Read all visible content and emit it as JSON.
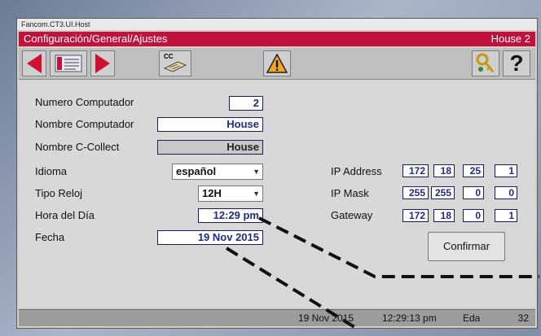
{
  "window": {
    "title": "Fancom.CT3.UI.Host"
  },
  "header": {
    "path": "Configuración/General/Ajustes",
    "house": "House 2"
  },
  "toolbar": {
    "back": "arrow-left-icon",
    "list": "list-card-icon",
    "forward": "arrow-right-icon",
    "cc_label": "CC",
    "warning": "warning-icon",
    "key": "key-icon",
    "help": "?"
  },
  "form": {
    "numero_computador": {
      "label": "Numero Computador",
      "value": "2"
    },
    "nombre_computador": {
      "label": "Nombre Computador",
      "value": "House"
    },
    "nombre_ccollect": {
      "label": "Nombre C-Collect",
      "value": "House"
    },
    "idioma": {
      "label": "Idioma",
      "value": "español"
    },
    "tipo_reloj": {
      "label": "Tipo Reloj",
      "value": "12H"
    },
    "hora_del_dia": {
      "label": "Hora del Día",
      "value": "12:29 pm"
    },
    "fecha": {
      "label": "Fecha",
      "value": "19 Nov 2015"
    }
  },
  "network": {
    "ip_address": {
      "label": "IP Address",
      "octets": [
        "172",
        "18",
        "25",
        "1"
      ]
    },
    "ip_mask": {
      "label": "IP Mask",
      "octets": [
        "255",
        "255",
        "0",
        "0"
      ]
    },
    "gateway": {
      "label": "Gateway",
      "octets": [
        "172",
        "18",
        "0",
        "1"
      ]
    },
    "confirm_label": "Confirmar"
  },
  "status": {
    "date": "19 Nov 2015",
    "time": "12:29:13 pm",
    "user": "Eda",
    "number": "32"
  },
  "colors": {
    "header": "#c1113d",
    "value_text": "#1f2a86",
    "arrow": "#d01030",
    "warning": "#f5a623"
  }
}
